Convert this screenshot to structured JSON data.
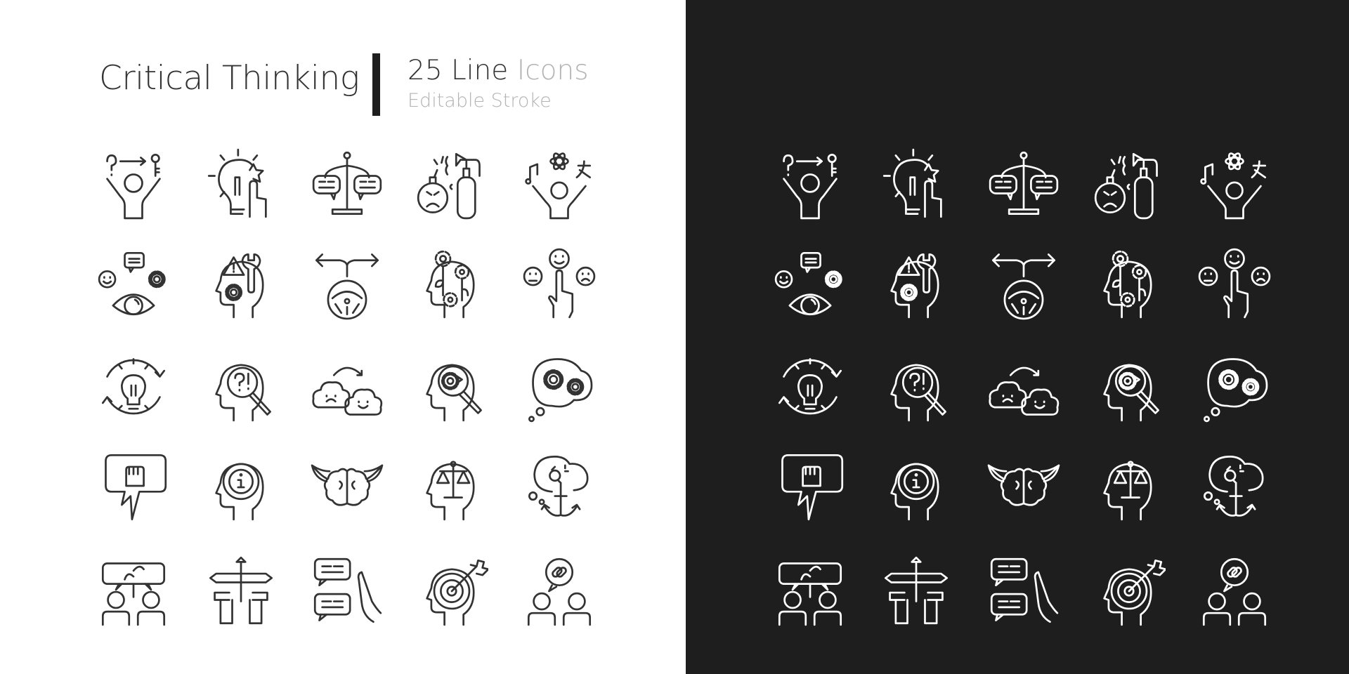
{
  "header": {
    "title": "Critical Thinking",
    "count_label": "25 Line",
    "count_label_gray": "Icons",
    "subtitle": "Editable Stroke"
  },
  "colors": {
    "light_bg": "#ffffff",
    "dark_bg": "#1e1e1e",
    "text": "#333333",
    "muted": "#b3b3b3",
    "light_icon": "#333333",
    "dark_icon": "#ffffff"
  },
  "icons": [
    "problem-solving-icon",
    "creative-idea-icon",
    "balanced-discussion-icon",
    "anger-control-icon",
    "multi-talent-icon",
    "observation-icon",
    "mental-troubleshoot-icon",
    "decision-wheel-icon",
    "mind-growth-icon",
    "emotion-choice-icon",
    "idea-cycle-icon",
    "question-search-icon",
    "mood-change-icon",
    "mind-analysis-icon",
    "thinking-gears-icon",
    "protest-speech-icon",
    "mind-info-icon",
    "winged-brain-icon",
    "fair-judgement-icon",
    "anchored-thought-icon",
    "shared-growth-icon",
    "crossroads-icon",
    "stop-talk-icon",
    "focused-mind-icon",
    "connected-people-icon"
  ]
}
